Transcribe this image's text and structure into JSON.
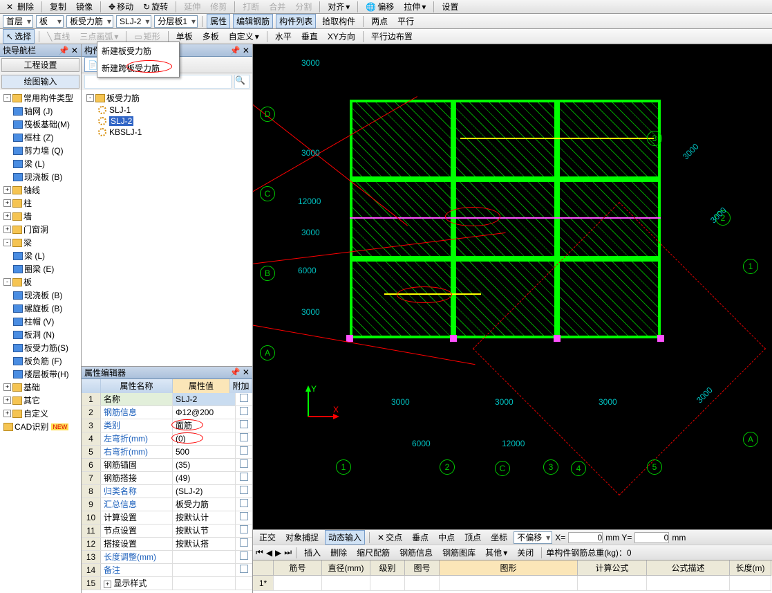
{
  "toolbar1": {
    "delete": "删除",
    "copy": "复制",
    "mirror": "镜像",
    "move": "移动",
    "rotate": "旋转",
    "extend": "延伸",
    "trim": "修剪",
    "break": "打断",
    "merge": "合并",
    "split": "分割",
    "align": "对齐",
    "offset": "偏移",
    "stretch": "拉伸",
    "settings": "设置"
  },
  "row2": {
    "floor": "首层",
    "cat": "板",
    "subcat": "板受力筋",
    "comp": "SLJ-2",
    "layer": "分层板1",
    "prop": "属性",
    "edit_rebar": "编辑钢筋",
    "comp_list": "构件列表",
    "pick": "拾取构件",
    "two_pt": "两点",
    "parallel": "平行"
  },
  "row3": {
    "select": "选择",
    "line": "直线",
    "arc": "三点画弧",
    "rect": "矩形",
    "single": "单板",
    "multi": "多板",
    "custom": "自定义",
    "horiz": "水平",
    "vert": "垂直",
    "xy": "XY方向",
    "parallel_side": "平行边布置"
  },
  "leftPanel": {
    "title": "快导航栏",
    "tab1": "工程设置",
    "tab2": "绘图输入"
  },
  "tree": [
    {
      "indent": 0,
      "fold": "-",
      "label": "常用构件类型"
    },
    {
      "indent": 1,
      "icon": "grid",
      "label": "轴网 (J)"
    },
    {
      "indent": 1,
      "icon": "blue",
      "label": "筏板基础(M)"
    },
    {
      "indent": 1,
      "icon": "blue",
      "label": "框柱 (Z)"
    },
    {
      "indent": 1,
      "icon": "blue",
      "label": "剪力墙 (Q)"
    },
    {
      "indent": 1,
      "icon": "blue",
      "label": "梁 (L)"
    },
    {
      "indent": 1,
      "icon": "blue",
      "label": "现浇板 (B)"
    },
    {
      "indent": 0,
      "fold": "+",
      "label": "轴线"
    },
    {
      "indent": 0,
      "fold": "+",
      "label": "柱"
    },
    {
      "indent": 0,
      "fold": "+",
      "label": "墙"
    },
    {
      "indent": 0,
      "fold": "+",
      "label": "门窗洞"
    },
    {
      "indent": 0,
      "fold": "-",
      "label": "梁"
    },
    {
      "indent": 1,
      "icon": "blue",
      "label": "梁 (L)"
    },
    {
      "indent": 1,
      "icon": "blue",
      "label": "圈梁 (E)"
    },
    {
      "indent": 0,
      "fold": "-",
      "label": "板"
    },
    {
      "indent": 1,
      "icon": "blue",
      "label": "现浇板 (B)"
    },
    {
      "indent": 1,
      "icon": "blue",
      "label": "螺旋板 (B)"
    },
    {
      "indent": 1,
      "icon": "blue",
      "label": "柱帽 (V)"
    },
    {
      "indent": 1,
      "icon": "blue",
      "label": "板洞 (N)"
    },
    {
      "indent": 1,
      "icon": "blue",
      "label": "板受力筋(S)"
    },
    {
      "indent": 1,
      "icon": "blue",
      "label": "板负筋 (F)"
    },
    {
      "indent": 1,
      "icon": "blue",
      "label": "楼层板带(H)"
    },
    {
      "indent": 0,
      "fold": "+",
      "label": "基础"
    },
    {
      "indent": 0,
      "fold": "+",
      "label": "其它"
    },
    {
      "indent": 0,
      "fold": "+",
      "label": "自定义"
    },
    {
      "indent": 0,
      "fold": "",
      "label": "CAD识别",
      "new": true
    }
  ],
  "midPanel": {
    "title": "构件列表",
    "new": "新建"
  },
  "dropdown": {
    "item1": "新建板受力筋",
    "item2": "新建跨板受力筋"
  },
  "compTree": {
    "root": "板受力筋",
    "items": [
      "SLJ-1",
      "SLJ-2",
      "KBSLJ-1"
    ],
    "sel": 1
  },
  "propPanel": {
    "title": "属性编辑器",
    "col1": "属性名称",
    "col2": "属性值",
    "col3": "附加"
  },
  "props": [
    {
      "n": "1",
      "name": "名称",
      "val": "SLJ-2",
      "hl": true
    },
    {
      "n": "2",
      "name": "钢筋信息",
      "val": "Φ12@200",
      "blue": true
    },
    {
      "n": "3",
      "name": "类别",
      "val": "面筋",
      "blue": true,
      "circ": true
    },
    {
      "n": "4",
      "name": "左弯折(mm)",
      "val": "(0)",
      "blue": true,
      "circ": true
    },
    {
      "n": "5",
      "name": "右弯折(mm)",
      "val": "500",
      "blue": true
    },
    {
      "n": "6",
      "name": "钢筋锚固",
      "val": "(35)"
    },
    {
      "n": "7",
      "name": "钢筋搭接",
      "val": "(49)"
    },
    {
      "n": "8",
      "name": "归类名称",
      "val": "(SLJ-2)",
      "blue": true
    },
    {
      "n": "9",
      "name": "汇总信息",
      "val": "板受力筋",
      "blue": true
    },
    {
      "n": "10",
      "name": "计算设置",
      "val": "按默认计"
    },
    {
      "n": "11",
      "name": "节点设置",
      "val": "按默认节"
    },
    {
      "n": "12",
      "name": "搭接设置",
      "val": "按默认搭"
    },
    {
      "n": "13",
      "name": "长度调整(mm)",
      "val": "",
      "blue": true
    },
    {
      "n": "14",
      "name": "备注",
      "val": "",
      "blue": true
    },
    {
      "n": "15",
      "name": "显示样式",
      "val": "",
      "exp": "+"
    }
  ],
  "status1": {
    "ortho": "正交",
    "snap": "对象捕捉",
    "dyn": "动态输入",
    "cross": "交点",
    "perp": "垂点",
    "mid": "中点",
    "top": "顶点",
    "coord": "坐标",
    "offset": "不偏移",
    "x": "X=",
    "y": "mm Y=",
    "mm": "mm"
  },
  "status2": {
    "insert": "插入",
    "delete": "删除",
    "scale": "缩尺配筋",
    "info": "钢筋信息",
    "lib": "钢筋图库",
    "other": "其他",
    "close": "关闭",
    "total": "单构件钢筋总重(kg)：0"
  },
  "btable": {
    "row": "1*",
    "cols": [
      "筋号",
      "直径(mm)",
      "级别",
      "图号",
      "图形",
      "计算公式",
      "公式描述",
      "长度(m)"
    ]
  },
  "xval": "0",
  "yval": "0",
  "dims": {
    "d3000": "3000",
    "d6000": "6000",
    "d12000": "12000"
  },
  "axes": {
    "A": "A",
    "B": "B",
    "C": "C",
    "D": "D",
    "n1": "1",
    "n2": "2",
    "n3": "3",
    "n4": "4",
    "n5": "5"
  }
}
